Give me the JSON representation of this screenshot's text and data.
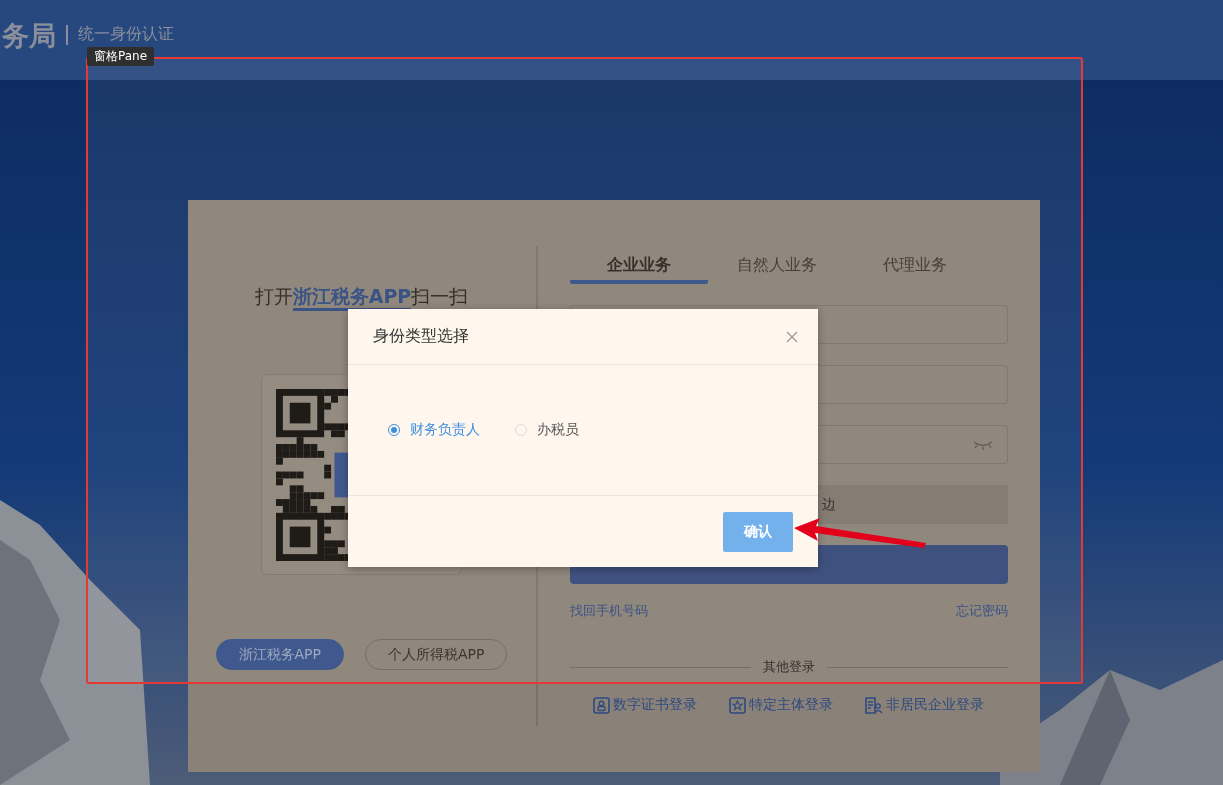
{
  "header": {
    "title": "务局",
    "subtitle": "统一身份认证"
  },
  "overlay_label": "窗格Pane",
  "qr_panel": {
    "heading": "打开**浙江税务APP**扫一扫",
    "apps": [
      {
        "label": "浙江税务APP",
        "selected": true
      },
      {
        "label": "个人所得税APP",
        "selected": false
      }
    ]
  },
  "login": {
    "tabs": [
      {
        "label": "企业业务",
        "selected": true
      },
      {
        "label": "自然人业务",
        "selected": false
      },
      {
        "label": "代理业务",
        "selected": false
      }
    ],
    "fields": [
      {
        "kind": "text"
      },
      {
        "kind": "text"
      },
      {
        "kind": "password"
      },
      {
        "kind": "slider",
        "text": "边"
      }
    ],
    "links": [
      "找回手机号码",
      "忘记密码"
    ],
    "other_login": {
      "title": "其他登录",
      "options": [
        {
          "label": "数字证书登录",
          "kind": "certificate"
        },
        {
          "label": "特定主体登录",
          "kind": "star"
        },
        {
          "label": "非居民企业登录",
          "kind": "document"
        }
      ]
    }
  },
  "dialog": {
    "title": "身份类型选择",
    "options": [
      {
        "label": "财务负责人",
        "selected": true
      },
      {
        "label": "办税员",
        "selected": false
      }
    ],
    "confirm": "确认"
  }
}
